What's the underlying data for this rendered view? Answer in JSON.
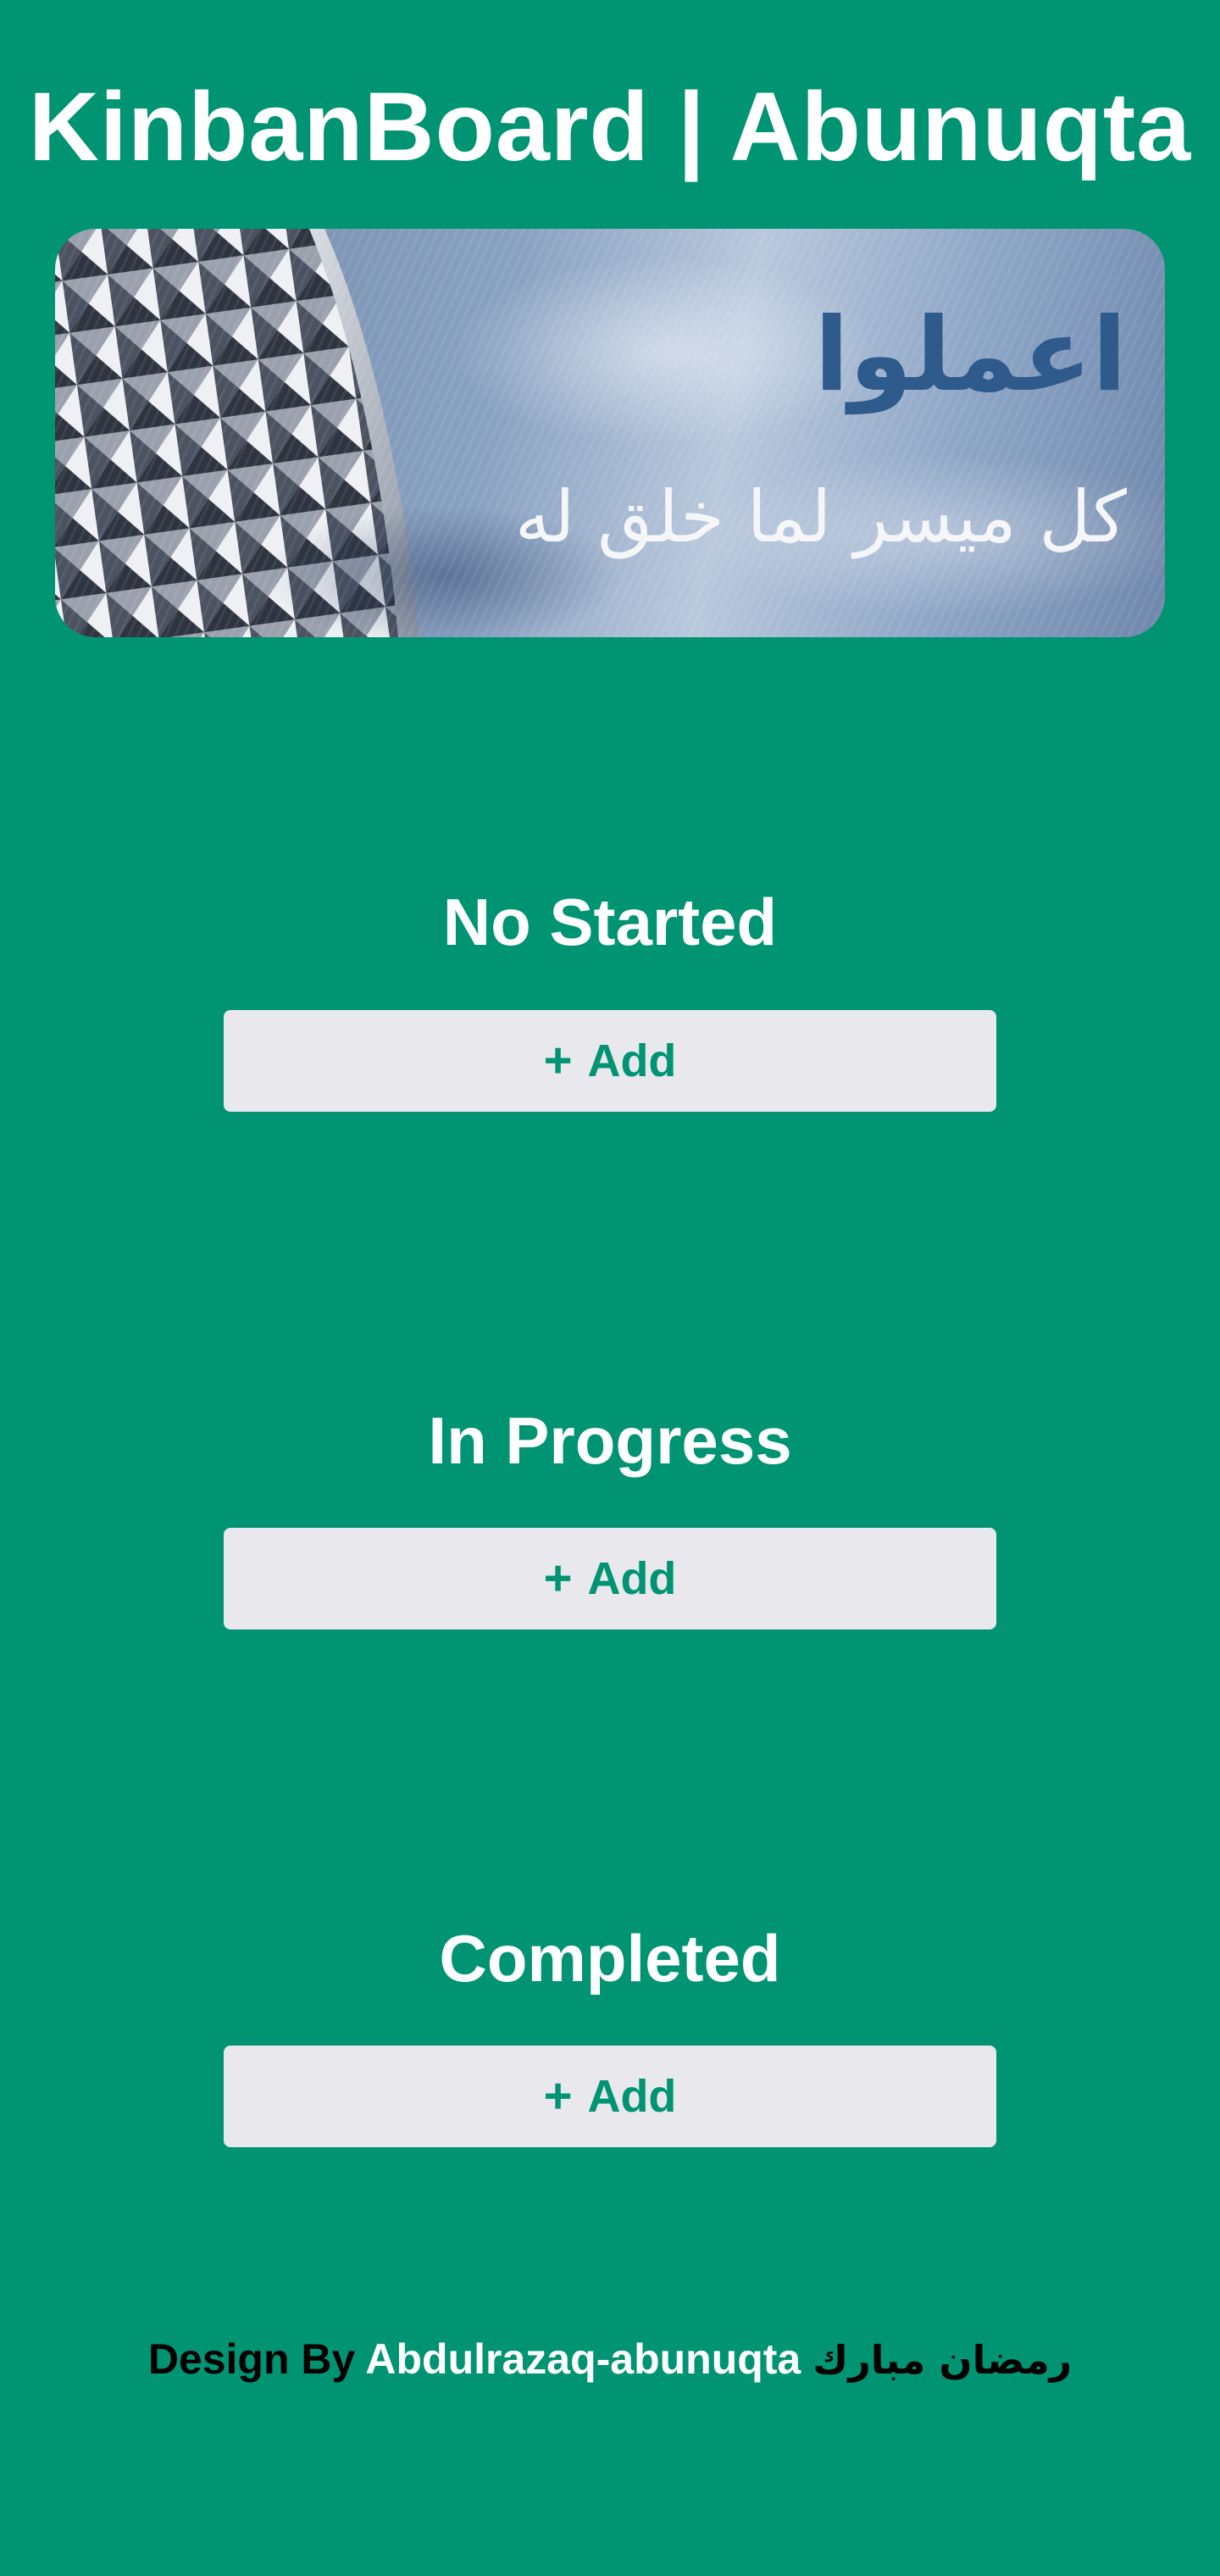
{
  "header": {
    "title": "KinbanBoard | Abunuqta"
  },
  "banner": {
    "headline": "اعملوا",
    "subline": "كل ميسر لما خلق له"
  },
  "columns": [
    {
      "title": "No Started",
      "add_label": "Add",
      "add_icon": "plus-icon"
    },
    {
      "title": "In Progress",
      "add_label": "Add",
      "add_icon": "plus-icon"
    },
    {
      "title": "Completed",
      "add_label": "Add",
      "add_icon": "plus-icon"
    }
  ],
  "footer": {
    "prefix": "Design By",
    "author": "Abdulrazaq-abunuqta",
    "greeting": "رمضان مبارك"
  },
  "colors": {
    "background": "#009473",
    "button_background": "#e9e8ec",
    "button_text": "#009473",
    "title_text": "#ffffff"
  }
}
